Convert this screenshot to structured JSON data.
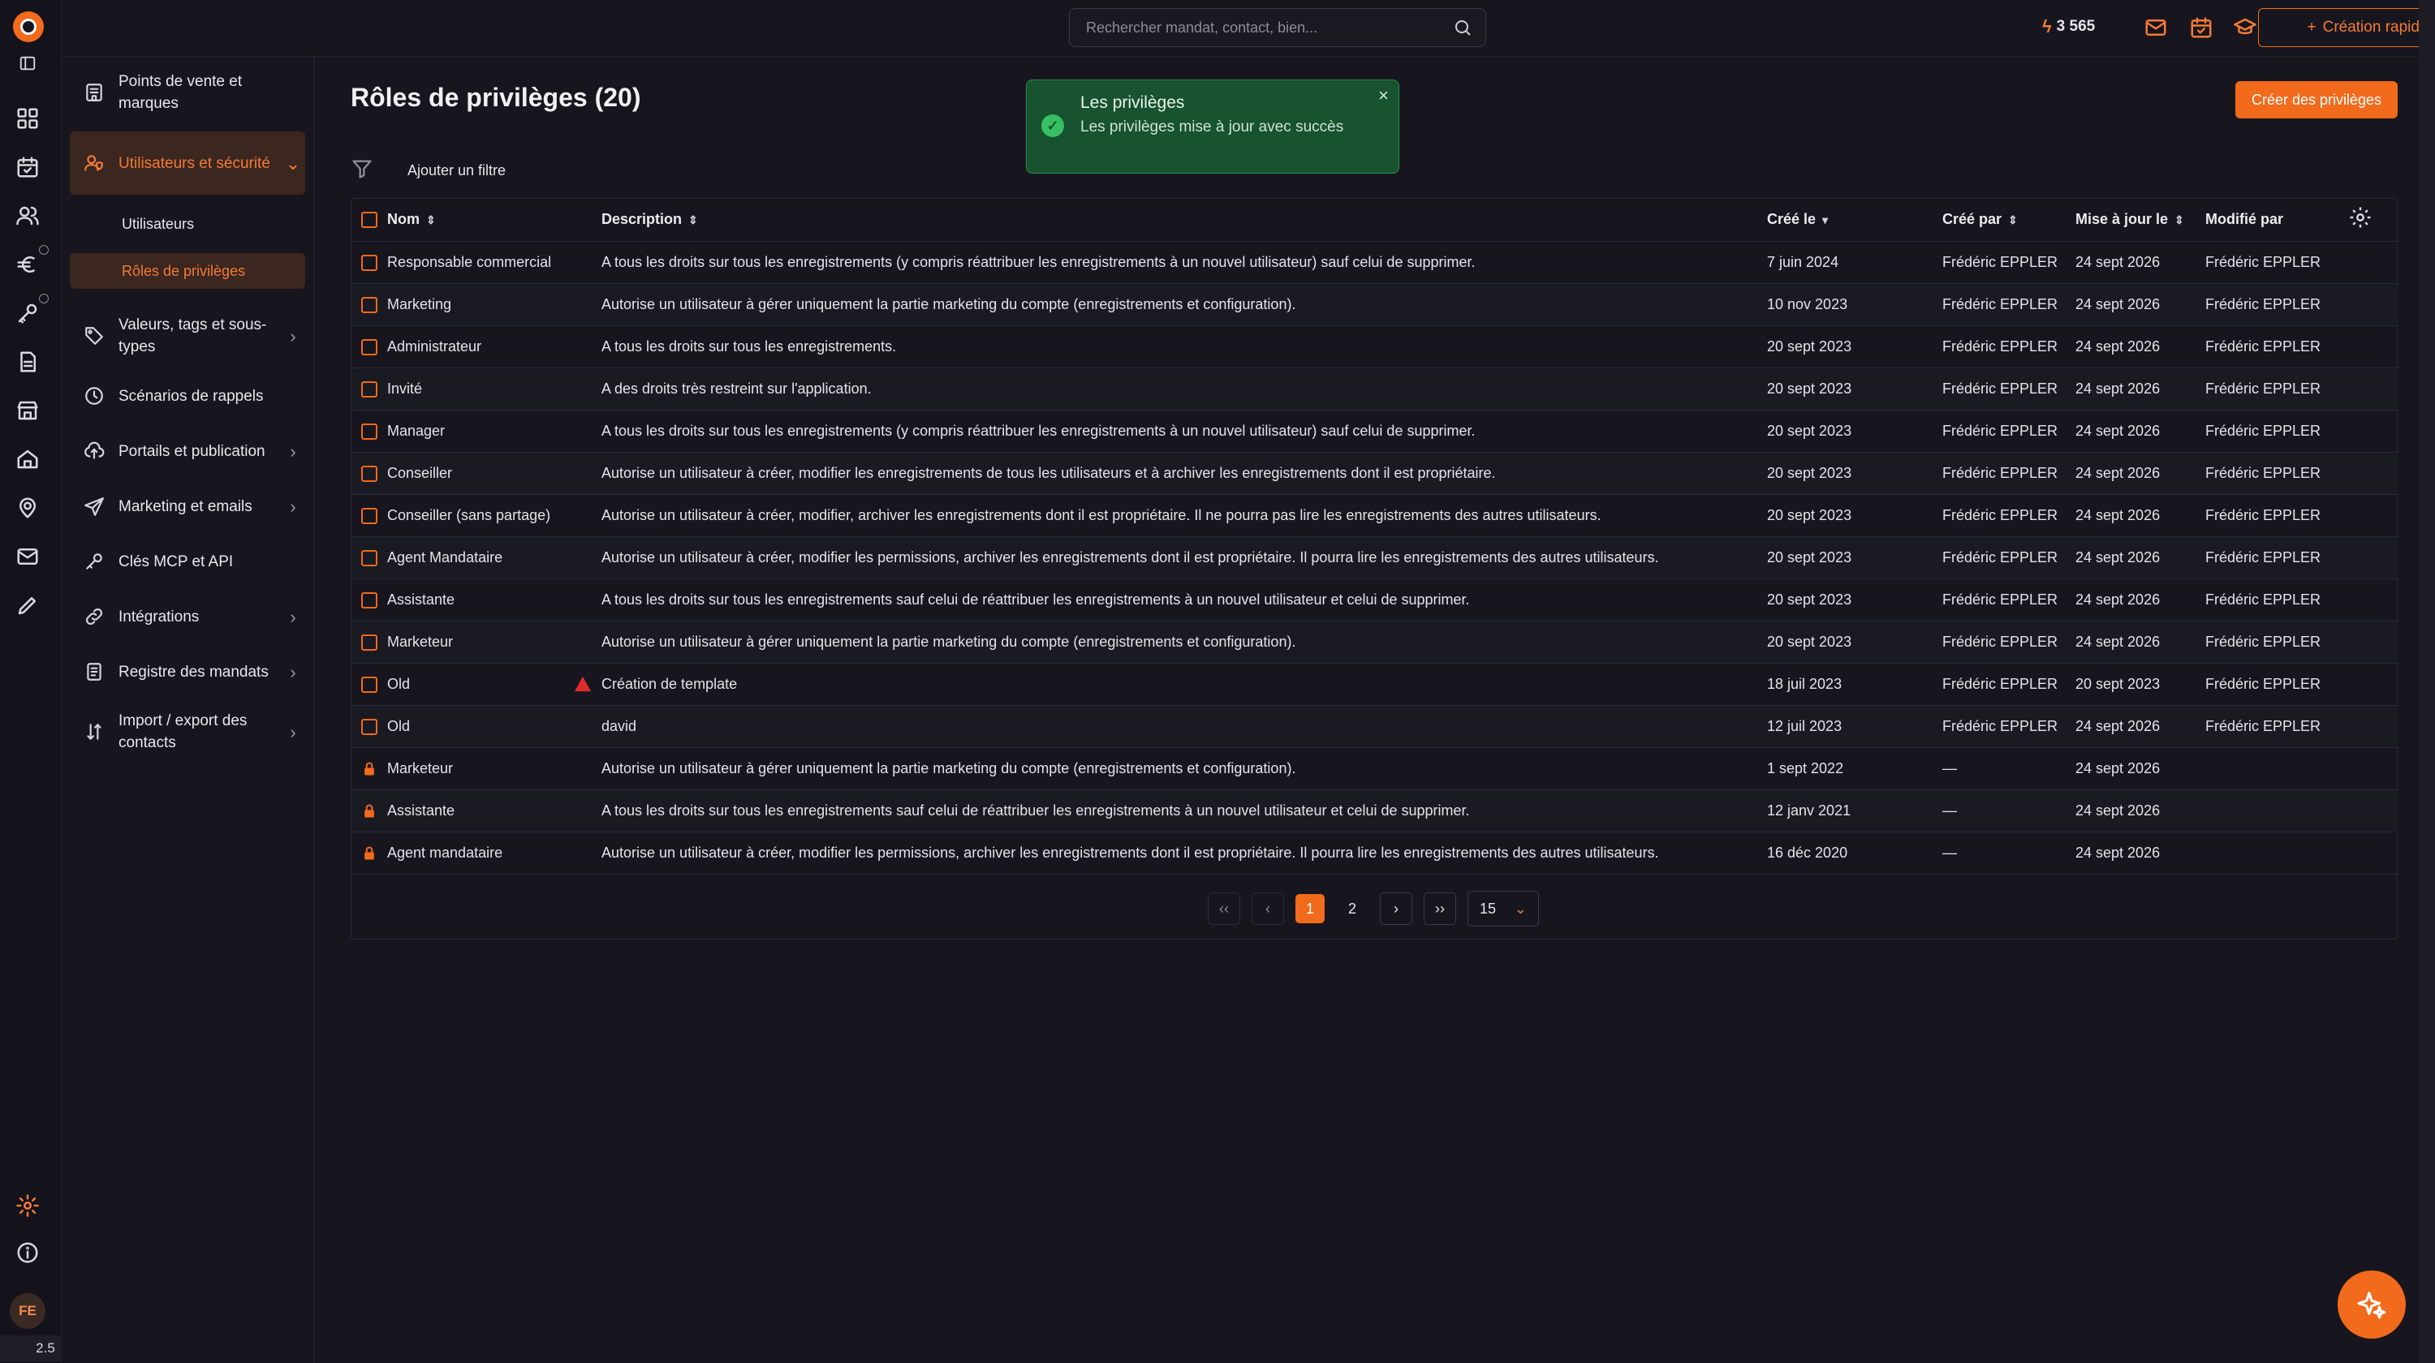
{
  "app": {
    "version": "2.5",
    "avatar_initials": "FE",
    "accent": "#f26a1b"
  },
  "topbar": {
    "search_placeholder": "Rechercher mandat, contact, bien...",
    "credits": "3 565",
    "quick_create_label": "Création rapide"
  },
  "sidebar": {
    "items": [
      {
        "label": "Points de vente et marques",
        "icon": "store-building-icon"
      },
      {
        "label": "Utilisateurs et sécurité",
        "icon": "users-shield-icon"
      },
      {
        "label": "Valeurs, tags et sous-types",
        "icon": "tag-icon"
      },
      {
        "label": "Scénarios de rappels",
        "icon": "clock-icon"
      },
      {
        "label": "Portails et publication",
        "icon": "cloud-upload-icon"
      },
      {
        "label": "Marketing et emails",
        "icon": "send-icon"
      },
      {
        "label": "Clés MCP et API",
        "icon": "key-icon"
      },
      {
        "label": "Intégrations",
        "icon": "link-icon"
      },
      {
        "label": "Registre des mandats",
        "icon": "register-icon"
      },
      {
        "label": "Import / export des contacts",
        "icon": "import-export-icon"
      }
    ],
    "sub_items": [
      {
        "label": "Utilisateurs"
      },
      {
        "label": "Rôles de privilèges"
      }
    ]
  },
  "page": {
    "title": "Rôles de privilèges (20)",
    "create_button": "Créer des privilèges",
    "add_filter": "Ajouter un filtre"
  },
  "toast": {
    "title": "Les privilèges",
    "message": "Les privilèges mise à jour avec succès"
  },
  "table": {
    "columns": {
      "name": "Nom",
      "description": "Description",
      "created": "Créé le",
      "created_by": "Créé par",
      "updated": "Mise à jour le",
      "modified_by": "Modifié par"
    },
    "rows": [
      {
        "name": "Responsable commercial",
        "description": "A tous les droits sur tous les enregistrements (y compris réattribuer les enregistrements à un nouvel utilisateur) sauf celui de supprimer.",
        "created": "7 juin 2024",
        "created_by": "Frédéric EPPLER",
        "updated": "24 sept 2026",
        "modified_by": "Frédéric EPPLER",
        "locked": false,
        "warning": false
      },
      {
        "name": "Marketing",
        "description": "Autorise un utilisateur à gérer uniquement la partie marketing du compte (enregistrements et configuration).",
        "created": "10 nov 2023",
        "created_by": "Frédéric EPPLER",
        "updated": "24 sept 2026",
        "modified_by": "Frédéric EPPLER",
        "locked": false,
        "warning": false
      },
      {
        "name": "Administrateur",
        "description": "A tous les droits sur tous les enregistrements.",
        "created": "20 sept 2023",
        "created_by": "Frédéric EPPLER",
        "updated": "24 sept 2026",
        "modified_by": "Frédéric EPPLER",
        "locked": false,
        "warning": false
      },
      {
        "name": "Invité",
        "description": "A des droits très restreint sur l'application.",
        "created": "20 sept 2023",
        "created_by": "Frédéric EPPLER",
        "updated": "24 sept 2026",
        "modified_by": "Frédéric EPPLER",
        "locked": false,
        "warning": false
      },
      {
        "name": "Manager",
        "description": "A tous les droits sur tous les enregistrements (y compris réattribuer les enregistrements à un nouvel utilisateur) sauf celui de supprimer.",
        "created": "20 sept 2023",
        "created_by": "Frédéric EPPLER",
        "updated": "24 sept 2026",
        "modified_by": "Frédéric EPPLER",
        "locked": false,
        "warning": false
      },
      {
        "name": "Conseiller",
        "description": "Autorise un utilisateur à créer, modifier les enregistrements de tous les utilisateurs et à archiver les enregistrements dont il est propriétaire.",
        "created": "20 sept 2023",
        "created_by": "Frédéric EPPLER",
        "updated": "24 sept 2026",
        "modified_by": "Frédéric EPPLER",
        "locked": false,
        "warning": false
      },
      {
        "name": "Conseiller (sans partage)",
        "description": "Autorise un utilisateur à créer, modifier, archiver les enregistrements dont il est propriétaire. Il ne pourra pas lire les enregistrements des autres utilisateurs.",
        "created": "20 sept 2023",
        "created_by": "Frédéric EPPLER",
        "updated": "24 sept 2026",
        "modified_by": "Frédéric EPPLER",
        "locked": false,
        "warning": false
      },
      {
        "name": "Agent Mandataire",
        "description": "Autorise un utilisateur à créer, modifier les permissions, archiver les enregistrements dont il est propriétaire. Il pourra lire les enregistrements des autres utilisateurs.",
        "created": "20 sept 2023",
        "created_by": "Frédéric EPPLER",
        "updated": "24 sept 2026",
        "modified_by": "Frédéric EPPLER",
        "locked": false,
        "warning": false
      },
      {
        "name": "Assistante",
        "description": "A tous les droits sur tous les enregistrements sauf celui de réattribuer les enregistrements à un nouvel utilisateur et celui de supprimer.",
        "created": "20 sept 2023",
        "created_by": "Frédéric EPPLER",
        "updated": "24 sept 2026",
        "modified_by": "Frédéric EPPLER",
        "locked": false,
        "warning": false
      },
      {
        "name": "Marketeur",
        "description": "Autorise un utilisateur à gérer uniquement la partie marketing du compte (enregistrements et configuration).",
        "created": "20 sept 2023",
        "created_by": "Frédéric EPPLER",
        "updated": "24 sept 2026",
        "modified_by": "Frédéric EPPLER",
        "locked": false,
        "warning": false
      },
      {
        "name": "Old",
        "description": "Création de template",
        "created": "18 juil 2023",
        "created_by": "Frédéric EPPLER",
        "updated": "20 sept 2023",
        "modified_by": "Frédéric EPPLER",
        "locked": false,
        "warning": true
      },
      {
        "name": "Old",
        "description": "david",
        "created": "12 juil 2023",
        "created_by": "Frédéric EPPLER",
        "updated": "24 sept 2026",
        "modified_by": "Frédéric EPPLER",
        "locked": false,
        "warning": false
      },
      {
        "name": "Marketeur",
        "description": "Autorise un utilisateur à gérer uniquement la partie marketing du compte (enregistrements et configuration).",
        "created": "1 sept 2022",
        "created_by": "—",
        "updated": "24 sept 2026",
        "modified_by": "",
        "locked": true,
        "warning": false
      },
      {
        "name": "Assistante",
        "description": "A tous les droits sur tous les enregistrements sauf celui de réattribuer les enregistrements à un nouvel utilisateur et celui de supprimer.",
        "created": "12 janv 2021",
        "created_by": "—",
        "updated": "24 sept 2026",
        "modified_by": "",
        "locked": true,
        "warning": false
      },
      {
        "name": "Agent mandataire",
        "description": "Autorise un utilisateur à créer, modifier les permissions, archiver les enregistrements dont il est propriétaire. Il pourra lire les enregistrements des autres utilisateurs.",
        "created": "16 déc 2020",
        "created_by": "—",
        "updated": "24 sept 2026",
        "modified_by": "",
        "locked": true,
        "warning": false
      }
    ]
  },
  "pagination": {
    "first": "‹‹",
    "prev": "‹",
    "current": "1",
    "page2": "2",
    "next": "›",
    "last": "››",
    "page_size": "15"
  }
}
